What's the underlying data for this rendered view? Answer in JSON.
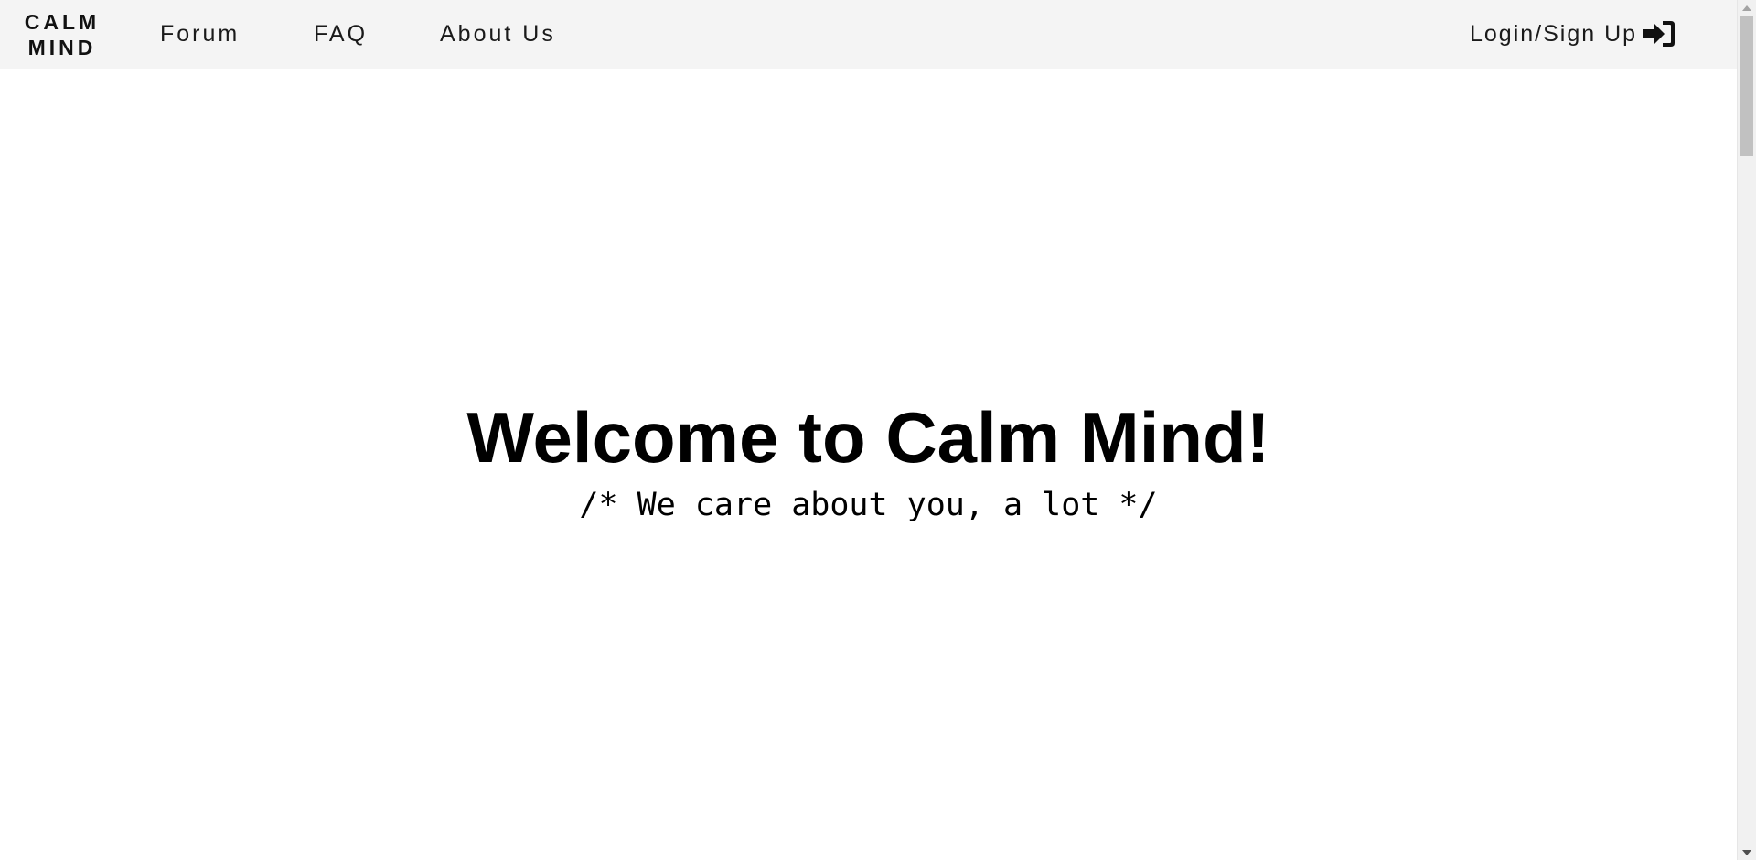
{
  "brand": {
    "line1": "CALM",
    "line2": "MIND"
  },
  "nav": {
    "links": [
      {
        "label": "Forum"
      },
      {
        "label": "FAQ"
      },
      {
        "label": "About Us"
      }
    ],
    "login": {
      "label": "Login/Sign Up",
      "icon": "sign-in-icon"
    }
  },
  "hero": {
    "title": "Welcome to Calm Mind!",
    "subtitle": "/* We care about you, a lot */"
  },
  "scrollbar": {
    "up_icon": "scroll-up-arrow-icon",
    "down_icon": "scroll-down-arrow-icon"
  },
  "colors": {
    "navbar_background": "#f4f4f4",
    "page_background": "#ffffff",
    "text": "#000000",
    "scrollbar_thumb": "#c1c1c1"
  }
}
